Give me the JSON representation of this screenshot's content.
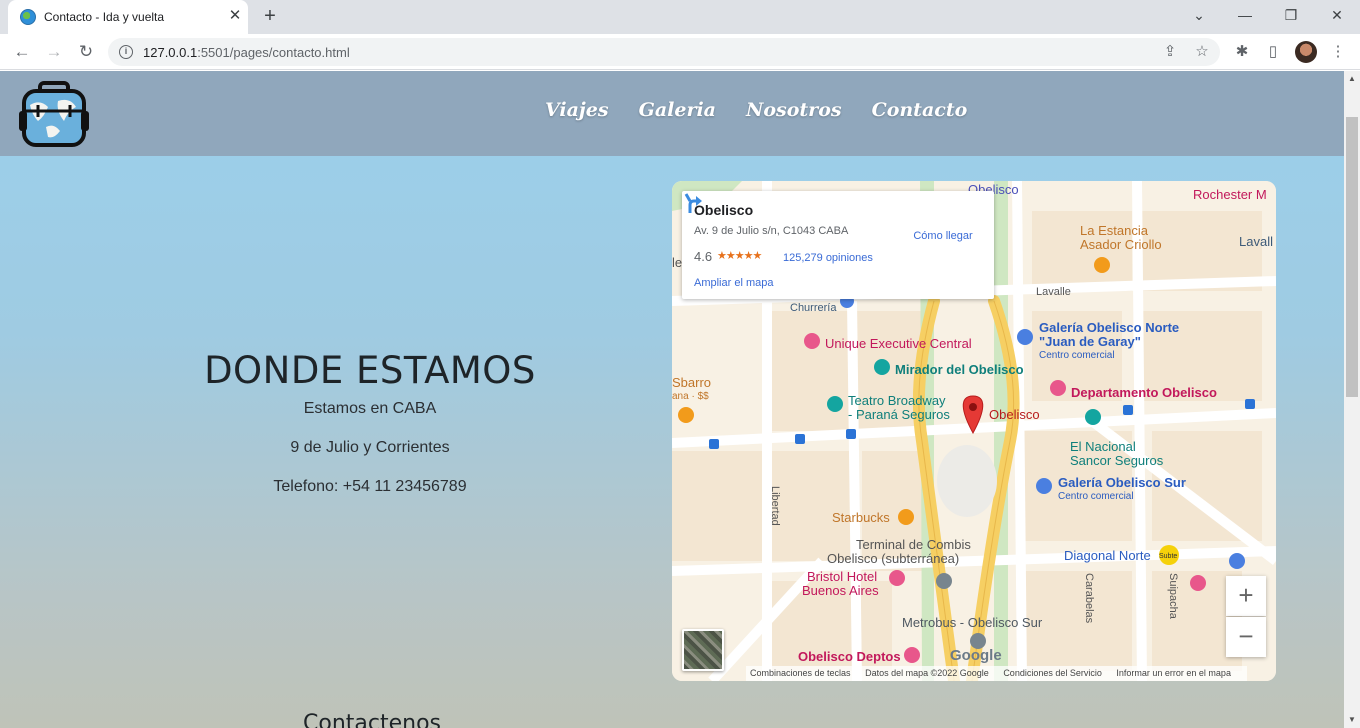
{
  "browser": {
    "tab_title": "Contacto - Ida y vuelta",
    "url_host": "127.0.0.1",
    "url_rest": ":5501/pages/contacto.html"
  },
  "site": {
    "nav": [
      "Viajes",
      "Galeria",
      "Nosotros",
      "Contacto"
    ]
  },
  "info": {
    "heading": "DONDE ESTAMOS",
    "line1": "Estamos en CABA",
    "line2": "9 de Julio y Corrientes",
    "line3": "Telefono: +54 11 23456789",
    "next_heading": "Contactenos"
  },
  "map": {
    "card": {
      "name": "Obelisco",
      "address": "Av. 9 de Julio s/n, C1043 CABA",
      "rating": "4.6",
      "stars": "★★★★★",
      "reviews": "125,279 opiniones",
      "enlarge": "Ampliar el mapa",
      "directions": "Cómo llegar"
    },
    "labels": {
      "obelisco_top": "Obelisco",
      "rochester": "Rochester M",
      "estancia1": "La Estancia",
      "estancia2": "Asador Criollo",
      "lavall": "Lavall",
      "lavalle": "Lavalle",
      "churreria": "Churrería",
      "unique": "Unique Executive Central",
      "mirador": "Mirador del Obelisco",
      "galeria_norte1": "Galería Obelisco Norte",
      "galeria_norte2": "\"Juan de Garay\"",
      "centro1": "Centro comercial",
      "sbarro": "Sbarro",
      "sbarro_sub": "ana · $$",
      "depto": "Departamento Obelisco",
      "teatro1": "Teatro Broadway",
      "teatro2": "- Paraná Seguros",
      "obelisco_pin": "Obelisco",
      "nacional1": "El Nacional",
      "nacional2": "Sancor Seguros",
      "galeria_sur": "Galería Obelisco Sur",
      "centro2": "Centro comercial",
      "libertad": "Libertad",
      "starbucks": "Starbucks",
      "terminal1": "Terminal de Combis",
      "terminal2": "Obelisco (subterránea)",
      "bristol1": "Bristol Hotel",
      "bristol2": "Buenos Aires",
      "diagonal": "Diagonal Norte",
      "carabelas": "Carabelas",
      "suipacha": "Suipacha",
      "metrobus": "Metrobus - Obelisco Sur",
      "deptos": "Obelisco Deptos",
      "le": "le",
      "subte": "Subte"
    },
    "zoom_in": "+",
    "zoom_out": "−",
    "google": "Google",
    "attrib": {
      "keys": "Combinaciones de teclas",
      "data": "Datos del mapa ©2022 Google",
      "terms": "Condiciones del Servicio",
      "report": "Informar un error en el mapa"
    }
  }
}
